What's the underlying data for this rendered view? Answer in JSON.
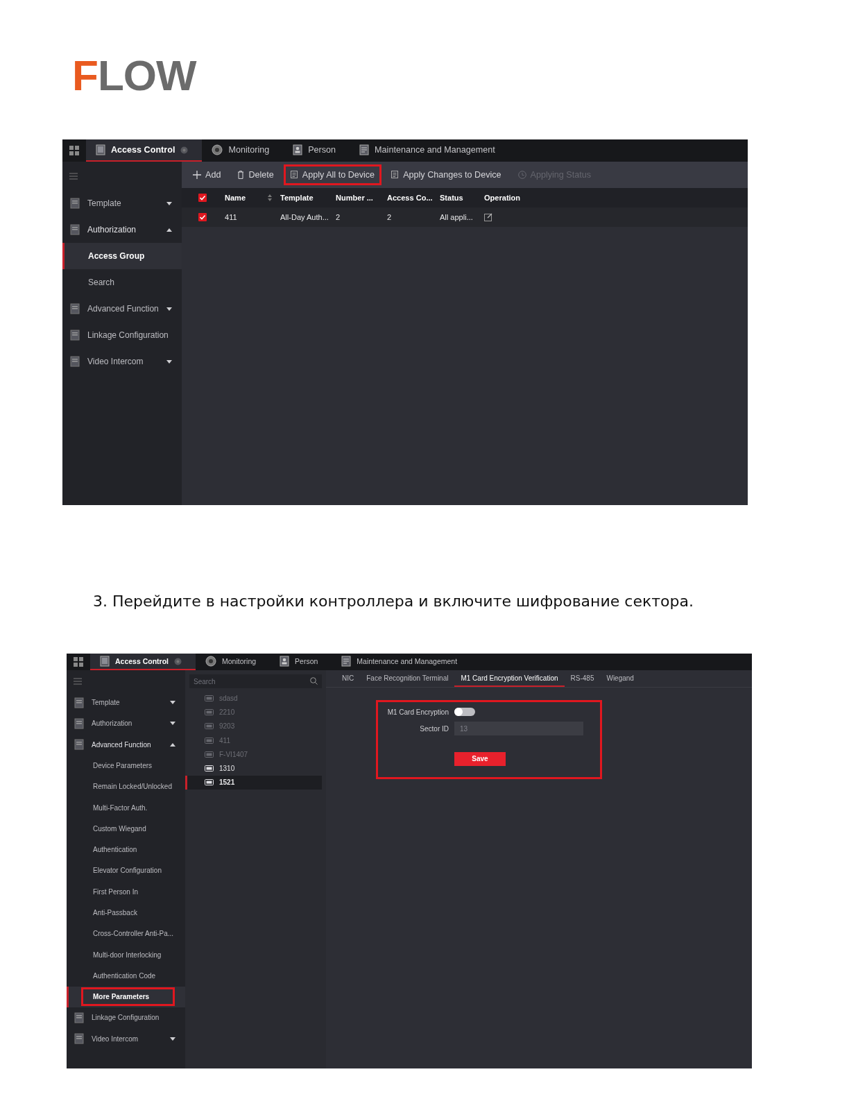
{
  "logo": {
    "text": "FLOW"
  },
  "screenshot_1": {
    "kind": "access_group",
    "top_tabs": [
      {
        "label": "Access Control",
        "selected": true
      },
      {
        "label": "Monitoring",
        "selected": false
      },
      {
        "label": "Person",
        "selected": false
      },
      {
        "label": "Maintenance and Management",
        "selected": false
      }
    ],
    "sidebar": [
      {
        "label": "Template",
        "kind": "menu",
        "expanded": false
      },
      {
        "label": "Authorization",
        "kind": "menu",
        "expanded": true,
        "children": [
          {
            "label": "Access Group",
            "selected": true,
            "highlighted": false
          },
          {
            "label": "Search",
            "selected": false,
            "highlighted": false
          }
        ]
      },
      {
        "label": "Advanced Function",
        "kind": "menu",
        "expanded": false
      },
      {
        "label": "Linkage Configuration",
        "kind": "link",
        "expanded": false
      },
      {
        "label": "Video Intercom",
        "kind": "menu",
        "expanded": false
      }
    ],
    "toolbar": [
      {
        "label": "Add",
        "kind": "add",
        "disabled": false,
        "highlighted": false
      },
      {
        "label": "Delete",
        "kind": "delete",
        "disabled": false,
        "highlighted": false
      },
      {
        "label": "Apply All to Device",
        "kind": "apply",
        "disabled": false,
        "highlighted": true
      },
      {
        "label": "Apply Changes to Device",
        "kind": "apply",
        "disabled": false,
        "highlighted": false
      },
      {
        "label": "Applying Status",
        "kind": "status",
        "disabled": true,
        "highlighted": false
      }
    ],
    "table": {
      "header_checked": true,
      "columns": [
        {
          "label": "Name",
          "sortable": true
        },
        {
          "label": "Template",
          "sortable": false
        },
        {
          "label": "Number ...",
          "sortable": false
        },
        {
          "label": "Access Co...",
          "sortable": false
        },
        {
          "label": "Status",
          "sortable": false
        },
        {
          "label": "Operation",
          "sortable": false
        }
      ],
      "rows": [
        {
          "checked": true,
          "cells": [
            "411",
            "All-Day Auth...",
            "2",
            "2",
            "All appli..."
          ]
        }
      ]
    }
  },
  "step_text": "3. Перейдите в настройки контроллера и включите шифрование сектора.",
  "screenshot_2": {
    "kind": "device_params",
    "top_tabs": [
      {
        "label": "Access Control",
        "selected": true
      },
      {
        "label": "Monitoring",
        "selected": false
      },
      {
        "label": "Person",
        "selected": false
      },
      {
        "label": "Maintenance and Management",
        "selected": false
      }
    ],
    "sidebar": [
      {
        "label": "Template",
        "kind": "menu",
        "expanded": false
      },
      {
        "label": "Authorization",
        "kind": "menu",
        "expanded": false
      },
      {
        "label": "Advanced Function",
        "kind": "menu",
        "expanded": true,
        "children": [
          {
            "label": "Device Parameters",
            "selected": false,
            "highlighted": false
          },
          {
            "label": "Remain Locked/Unlocked",
            "selected": false,
            "highlighted": false
          },
          {
            "label": "Multi-Factor Auth.",
            "selected": false,
            "highlighted": false
          },
          {
            "label": "Custom Wiegand",
            "selected": false,
            "highlighted": false
          },
          {
            "label": "Authentication",
            "selected": false,
            "highlighted": false
          },
          {
            "label": "Elevator Configuration",
            "selected": false,
            "highlighted": false
          },
          {
            "label": "First Person In",
            "selected": false,
            "highlighted": false
          },
          {
            "label": "Anti-Passback",
            "selected": false,
            "highlighted": false
          },
          {
            "label": "Cross-Controller Anti-Pa...",
            "selected": false,
            "highlighted": false
          },
          {
            "label": "Multi-door Interlocking",
            "selected": false,
            "highlighted": false
          },
          {
            "label": "Authentication Code",
            "selected": false,
            "highlighted": false
          },
          {
            "label": "More Parameters",
            "selected": true,
            "highlighted": true
          }
        ]
      },
      {
        "label": "Linkage Configuration",
        "kind": "link",
        "expanded": false
      },
      {
        "label": "Video Intercom",
        "kind": "menu",
        "expanded": false
      }
    ],
    "search": {
      "placeholder": "Search"
    },
    "devices": [
      {
        "label": "sdasd",
        "online": false,
        "selected": false
      },
      {
        "label": "2210",
        "online": false,
        "selected": false
      },
      {
        "label": "9203",
        "online": false,
        "selected": false
      },
      {
        "label": "411",
        "online": false,
        "selected": false
      },
      {
        "label": "F-VI1407",
        "online": false,
        "selected": false
      },
      {
        "label": "1310",
        "online": true,
        "selected": false
      },
      {
        "label": "1521",
        "online": true,
        "selected": true
      }
    ],
    "sub_tabs": [
      {
        "label": "NIC",
        "selected": false
      },
      {
        "label": "Face Recognition Terminal",
        "selected": false
      },
      {
        "label": "M1 Card Encryption Verification",
        "selected": true
      },
      {
        "label": "RS-485",
        "selected": false
      },
      {
        "label": "Wiegand",
        "selected": false
      }
    ],
    "form": {
      "highlighted": true,
      "toggle": {
        "label": "M1 Card Encryption",
        "on": false
      },
      "sector": {
        "label": "Sector ID",
        "value": "13"
      },
      "save": "Save"
    }
  }
}
